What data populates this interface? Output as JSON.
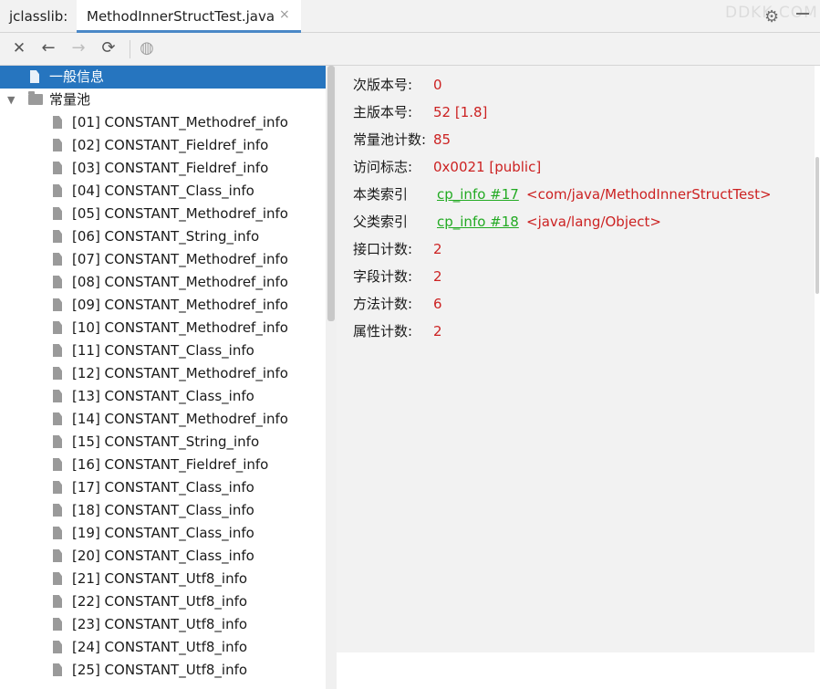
{
  "tabbar": {
    "tool_title": "jclasslib:",
    "active_tab": "MethodInnerStructTest.java",
    "close_glyph": "×",
    "watermark": "DDKK.COM"
  },
  "toolbar": {
    "icons": [
      "close-icon",
      "back-arrow-icon",
      "forward-arrow-icon",
      "refresh-icon",
      "web-globe-icon"
    ]
  },
  "tree": {
    "general": "一般信息",
    "constant_pool": "常量池",
    "items": [
      "[01] CONSTANT_Methodref_info",
      "[02] CONSTANT_Fieldref_info",
      "[03] CONSTANT_Fieldref_info",
      "[04] CONSTANT_Class_info",
      "[05] CONSTANT_Methodref_info",
      "[06] CONSTANT_String_info",
      "[07] CONSTANT_Methodref_info",
      "[08] CONSTANT_Methodref_info",
      "[09] CONSTANT_Methodref_info",
      "[10] CONSTANT_Methodref_info",
      "[11] CONSTANT_Class_info",
      "[12] CONSTANT_Methodref_info",
      "[13] CONSTANT_Class_info",
      "[14] CONSTANT_Methodref_info",
      "[15] CONSTANT_String_info",
      "[16] CONSTANT_Fieldref_info",
      "[17] CONSTANT_Class_info",
      "[18] CONSTANT_Class_info",
      "[19] CONSTANT_Class_info",
      "[20] CONSTANT_Class_info",
      "[21] CONSTANT_Utf8_info",
      "[22] CONSTANT_Utf8_info",
      "[23] CONSTANT_Utf8_info",
      "[24] CONSTANT_Utf8_info",
      "[25] CONSTANT_Utf8_info"
    ]
  },
  "details": {
    "minor_version": {
      "label": "次版本号:",
      "value": "0"
    },
    "major_version": {
      "label": "主版本号:",
      "value": "52 [1.8]"
    },
    "constant_pool_count": {
      "label": "常量池计数:",
      "value": "85"
    },
    "access_flags": {
      "label": "访问标志:",
      "value": "0x0021 [public]"
    },
    "this_class": {
      "label": "本类索引",
      "link": "cp_info #17",
      "value": "<com/java/MethodInnerStructTest>"
    },
    "super_class": {
      "label": "父类索引",
      "link": "cp_info #18",
      "value": "<java/lang/Object>"
    },
    "interfaces_count": {
      "label": "接口计数:",
      "value": "2"
    },
    "fields_count": {
      "label": "字段计数:",
      "value": "2"
    },
    "methods_count": {
      "label": "方法计数:",
      "value": "6"
    },
    "attributes_count": {
      "label": "属性计数:",
      "value": "2"
    }
  },
  "colors": {
    "selection": "#2675bf",
    "value_red": "#cc2222",
    "link_green": "#22aa22",
    "tab_underline": "#4a88c7"
  }
}
